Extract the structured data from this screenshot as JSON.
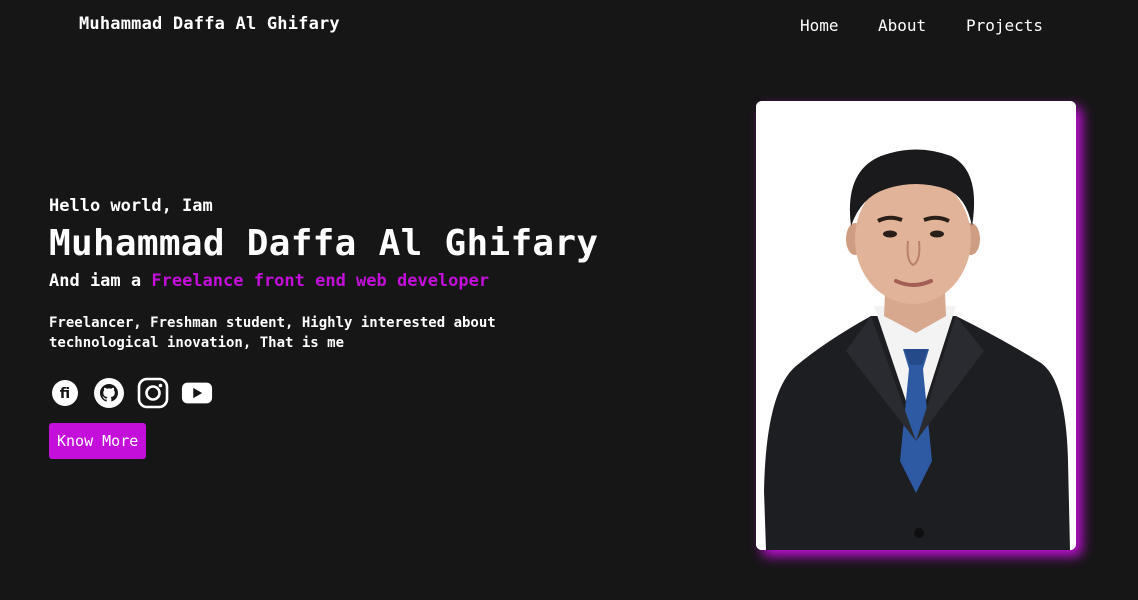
{
  "nav": {
    "brand": "Muhammad Daffa Al Ghifary",
    "links": [
      "Home",
      "About",
      "Projects"
    ]
  },
  "hero": {
    "greeting": "Hello world, Iam",
    "name": "Muhammad Daffa Al Ghifary",
    "role_prefix": "And iam a ",
    "role_highlight": "Freelance front end web developer",
    "bio": "Freelancer, Freshman student, Highly interested about technological inovation, That is me",
    "cta_label": "Know More",
    "socials": [
      "fastwork-icon",
      "github-icon",
      "instagram-icon",
      "youtube-icon"
    ]
  },
  "colors": {
    "background": "#161616",
    "accent": "#c30fd9",
    "text": "#ffffff"
  }
}
